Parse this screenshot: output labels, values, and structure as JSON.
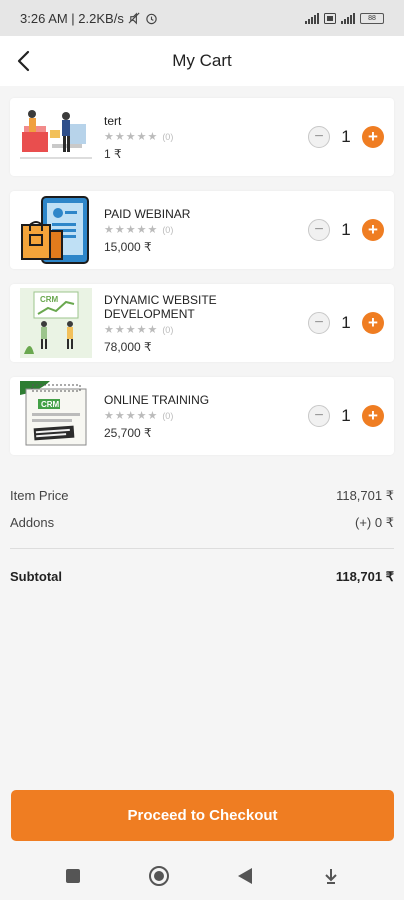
{
  "status_bar": {
    "left_text": "3:26 AM | 2.2KB/s",
    "battery": "88"
  },
  "header": {
    "title": "My Cart"
  },
  "items": [
    {
      "name": "tert",
      "stars": "★★★★★",
      "rating_count": "(0)",
      "price": "1 ₹",
      "qty": "1",
      "icon": "shopping-illustration"
    },
    {
      "name": "PAID WEBINAR",
      "stars": "★★★★★",
      "rating_count": "(0)",
      "price": "15,000 ₹",
      "qty": "1",
      "icon": "webinar-illustration"
    },
    {
      "name": "DYNAMIC WEBSITE DEVELOPMENT",
      "stars": "★★★★★",
      "rating_count": "(0)",
      "price": "78,000 ₹",
      "qty": "1",
      "icon": "crm-illustration"
    },
    {
      "name": "ONLINE TRAINING",
      "stars": "★★★★★",
      "rating_count": "(0)",
      "price": "25,700 ₹",
      "qty": "1",
      "icon": "crm-calendar-illustration"
    }
  ],
  "qty_controls": {
    "minus": "−",
    "plus": "+"
  },
  "summary": {
    "item_price_label": "Item Price",
    "item_price_value": "118,701 ₹",
    "addons_label": "Addons",
    "addons_value": "(+) 0 ₹",
    "subtotal_label": "Subtotal",
    "subtotal_value": "118,701 ₹"
  },
  "checkout": {
    "label": "Proceed to Checkout"
  },
  "colors": {
    "accent": "#ef7d22",
    "background": "#f5f5f5"
  }
}
